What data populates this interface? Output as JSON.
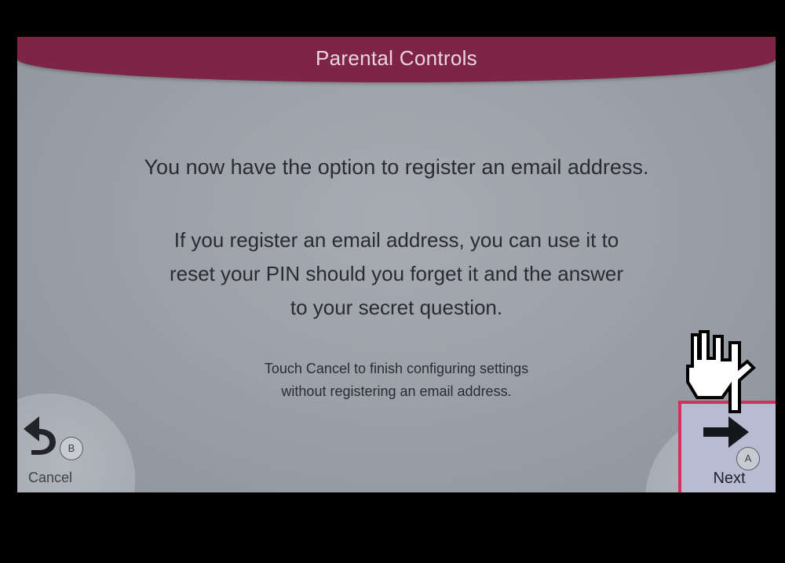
{
  "header": {
    "title": "Parental Controls"
  },
  "content": {
    "intro": "You now have the option to register an email address.",
    "detail_lines": [
      "If you register an email address, you can use it to",
      "reset your PIN should you forget it and the answer",
      "to your secret question."
    ],
    "note_lines": [
      "Touch Cancel to finish configuring settings",
      "without registering an email address."
    ]
  },
  "buttons": {
    "cancel": {
      "label": "Cancel",
      "badge": "B",
      "icon": "back-arrow-icon"
    },
    "next": {
      "label": "Next",
      "badge": "A",
      "icon": "right-arrow-icon"
    }
  },
  "cursor": {
    "icon": "pointing-hand-cursor-icon"
  },
  "colors": {
    "header": "#7e2446",
    "highlight_border": "#d4305f",
    "screen": "#9a9ea6"
  }
}
